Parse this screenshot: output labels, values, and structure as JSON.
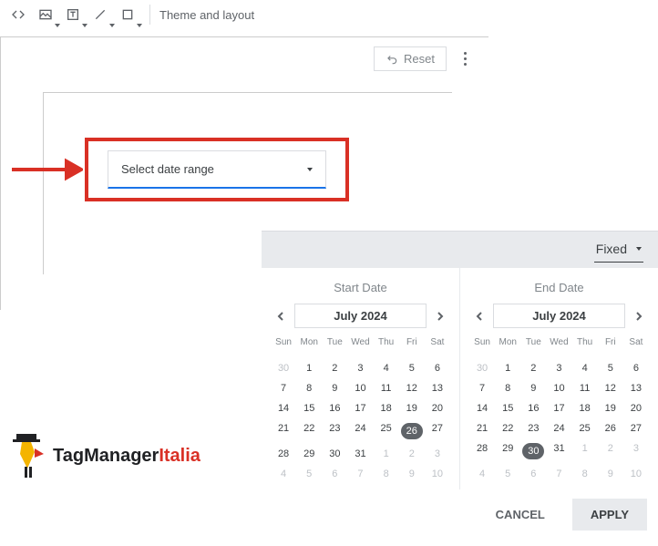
{
  "toolbar": {
    "theme_label": "Theme and layout"
  },
  "panel_top": {
    "reset": "Reset"
  },
  "control": {
    "placeholder": "Select date range"
  },
  "picker": {
    "mode": "Fixed",
    "start_label": "Start Date",
    "end_label": "End Date",
    "dow": [
      "Sun",
      "Mon",
      "Tue",
      "Wed",
      "Thu",
      "Fri",
      "Sat"
    ],
    "start": {
      "month": "July 2024",
      "selected": 26,
      "cells": [
        {
          "n": 30,
          "m": true
        },
        {
          "n": 1
        },
        {
          "n": 2
        },
        {
          "n": 3
        },
        {
          "n": 4
        },
        {
          "n": 5
        },
        {
          "n": 6
        },
        {
          "n": 7
        },
        {
          "n": 8
        },
        {
          "n": 9
        },
        {
          "n": 10
        },
        {
          "n": 11
        },
        {
          "n": 12
        },
        {
          "n": 13
        },
        {
          "n": 14
        },
        {
          "n": 15
        },
        {
          "n": 16
        },
        {
          "n": 17
        },
        {
          "n": 18
        },
        {
          "n": 19
        },
        {
          "n": 20
        },
        {
          "n": 21
        },
        {
          "n": 22
        },
        {
          "n": 23
        },
        {
          "n": 24
        },
        {
          "n": 25
        },
        {
          "n": 26
        },
        {
          "n": 27
        },
        {
          "n": 28
        },
        {
          "n": 29
        },
        {
          "n": 30
        },
        {
          "n": 31
        },
        {
          "n": 1,
          "m": true
        },
        {
          "n": 2,
          "m": true
        },
        {
          "n": 3,
          "m": true
        },
        {
          "n": 4,
          "m": true
        },
        {
          "n": 5,
          "m": true
        },
        {
          "n": 6,
          "m": true
        },
        {
          "n": 7,
          "m": true
        },
        {
          "n": 8,
          "m": true
        },
        {
          "n": 9,
          "m": true
        },
        {
          "n": 10,
          "m": true
        }
      ]
    },
    "end": {
      "month": "July 2024",
      "selected": 30,
      "cells": [
        {
          "n": 30,
          "m": true
        },
        {
          "n": 1
        },
        {
          "n": 2
        },
        {
          "n": 3
        },
        {
          "n": 4
        },
        {
          "n": 5
        },
        {
          "n": 6
        },
        {
          "n": 7
        },
        {
          "n": 8
        },
        {
          "n": 9
        },
        {
          "n": 10
        },
        {
          "n": 11
        },
        {
          "n": 12
        },
        {
          "n": 13
        },
        {
          "n": 14
        },
        {
          "n": 15
        },
        {
          "n": 16
        },
        {
          "n": 17
        },
        {
          "n": 18
        },
        {
          "n": 19
        },
        {
          "n": 20
        },
        {
          "n": 21
        },
        {
          "n": 22
        },
        {
          "n": 23
        },
        {
          "n": 24
        },
        {
          "n": 25
        },
        {
          "n": 26
        },
        {
          "n": 27
        },
        {
          "n": 28
        },
        {
          "n": 29
        },
        {
          "n": 30
        },
        {
          "n": 31
        },
        {
          "n": 1,
          "m": true
        },
        {
          "n": 2,
          "m": true
        },
        {
          "n": 3,
          "m": true
        },
        {
          "n": 4,
          "m": true
        },
        {
          "n": 5,
          "m": true
        },
        {
          "n": 6,
          "m": true
        },
        {
          "n": 7,
          "m": true
        },
        {
          "n": 8,
          "m": true
        },
        {
          "n": 9,
          "m": true
        },
        {
          "n": 10,
          "m": true
        }
      ]
    },
    "cancel": "CANCEL",
    "apply": "APPLY"
  },
  "logo": {
    "a": "TagManager",
    "b": "Italia"
  }
}
